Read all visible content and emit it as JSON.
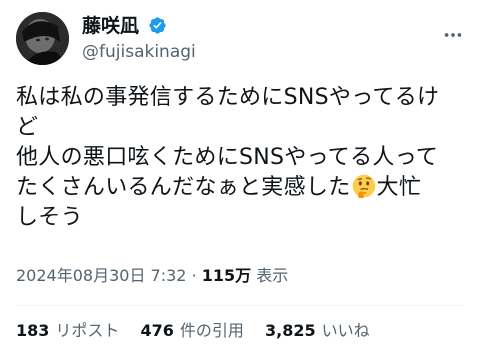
{
  "author": {
    "display_name": "藤咲凪",
    "handle": "@fujisakinagi",
    "verified": true,
    "avatar_icon": "avatar-image"
  },
  "tweet": {
    "lines": [
      "私は私の事発信するためにSNSやってるけ",
      "ど",
      "他人の悪口呟くためにSNSやってる人って",
      "たくさんいるんだなぁと実感した",
      "大忙",
      "しそう"
    ],
    "emoji": "thinking-face"
  },
  "meta": {
    "timestamp": "2024年08月30日 7:32",
    "separator": "·",
    "views_count": "115万",
    "views_label": "表示"
  },
  "stats": {
    "reposts_count": "183",
    "reposts_label": "リポスト",
    "quotes_count": "476",
    "quotes_label": "件の引用",
    "likes_count": "3,825",
    "likes_label": "いいね"
  },
  "colors": {
    "text": "#0f1419",
    "secondary": "#536471",
    "verified_blue": "#1d9bf0",
    "divider": "#eff3f4"
  },
  "icons": {
    "verified": "verified-badge-icon",
    "more": "more-options-icon"
  }
}
